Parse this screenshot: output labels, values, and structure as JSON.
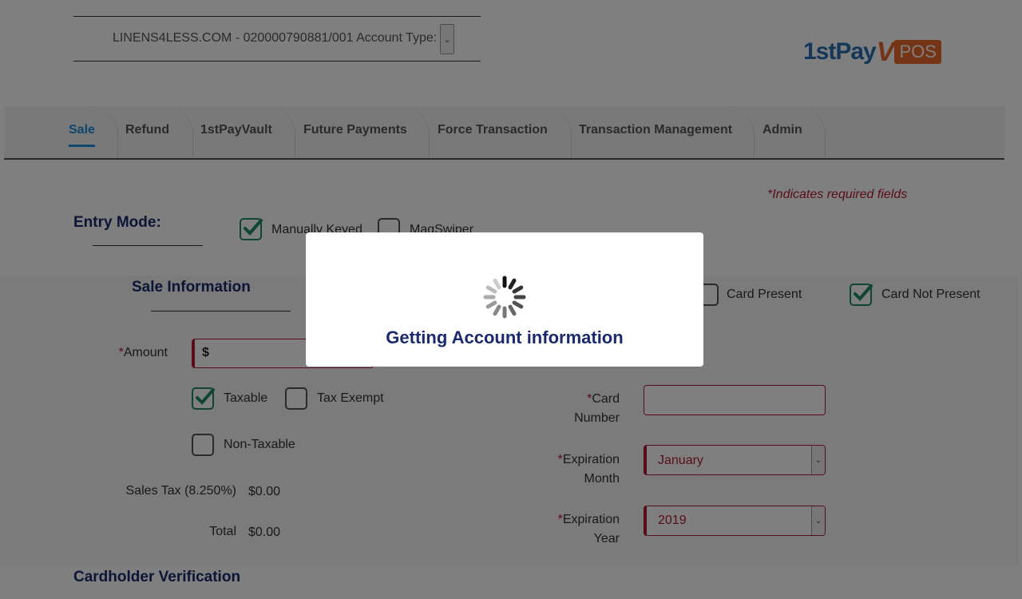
{
  "header": {
    "account_text": "LINENS4LESS.COM - 020000790881/001 Account Type:",
    "account_select_value": "",
    "logo": {
      "part1": "1st",
      "part2": "Pay",
      "part3": "V",
      "part4": "POS"
    }
  },
  "tabs": [
    {
      "label": "Sale",
      "active": true
    },
    {
      "label": "Refund",
      "active": false
    },
    {
      "label": "1stPayVault",
      "active": false
    },
    {
      "label": "Future Payments",
      "active": false
    },
    {
      "label": "Force Transaction",
      "active": false
    },
    {
      "label": "Transaction Management",
      "active": false
    },
    {
      "label": "Admin",
      "active": false
    }
  ],
  "required_note": {
    "star": "*",
    "text": "Indicates required fields"
  },
  "entry_mode": {
    "label": "Entry Mode:",
    "options": [
      {
        "label": "Manually Keyed",
        "checked": true
      },
      {
        "label": "MagSwiper",
        "checked": false
      }
    ]
  },
  "sale_info": {
    "title": "Sale Information",
    "amount_label": "Amount",
    "amount_prefix": "$",
    "amount_value": "",
    "tax_options": [
      {
        "label": "Taxable",
        "checked": true
      },
      {
        "label": "Tax Exempt",
        "checked": false
      },
      {
        "label": "Non-Taxable",
        "checked": false
      }
    ],
    "sales_tax_label": "Sales Tax (8.250%)",
    "sales_tax_value": "$0.00",
    "total_label": "Total",
    "total_value": "$0.00"
  },
  "card_info": {
    "presence_options": [
      {
        "label": "Card Present",
        "checked": false
      },
      {
        "label": "Card Not Present",
        "checked": true
      }
    ],
    "card_number_label_1": "Card",
    "card_number_label_2": "Number",
    "card_number_value": "",
    "exp_month_label_1": "Expiration",
    "exp_month_label_2": "Month",
    "exp_month_value": "January",
    "exp_year_label_1": "Expiration",
    "exp_year_label_2": "Year",
    "exp_year_value": "2019",
    "required_star": "*"
  },
  "cardholder_verification": {
    "title": "Cardholder Verification"
  },
  "loading_modal": {
    "message": "Getting Account information"
  },
  "colors": {
    "accent": "#1b8fd8",
    "heading": "#1a2a6c",
    "required": "#b31b34",
    "check": "#1f8a62",
    "logo_blue": "#2a6fb0",
    "logo_orange": "#e8692a"
  }
}
